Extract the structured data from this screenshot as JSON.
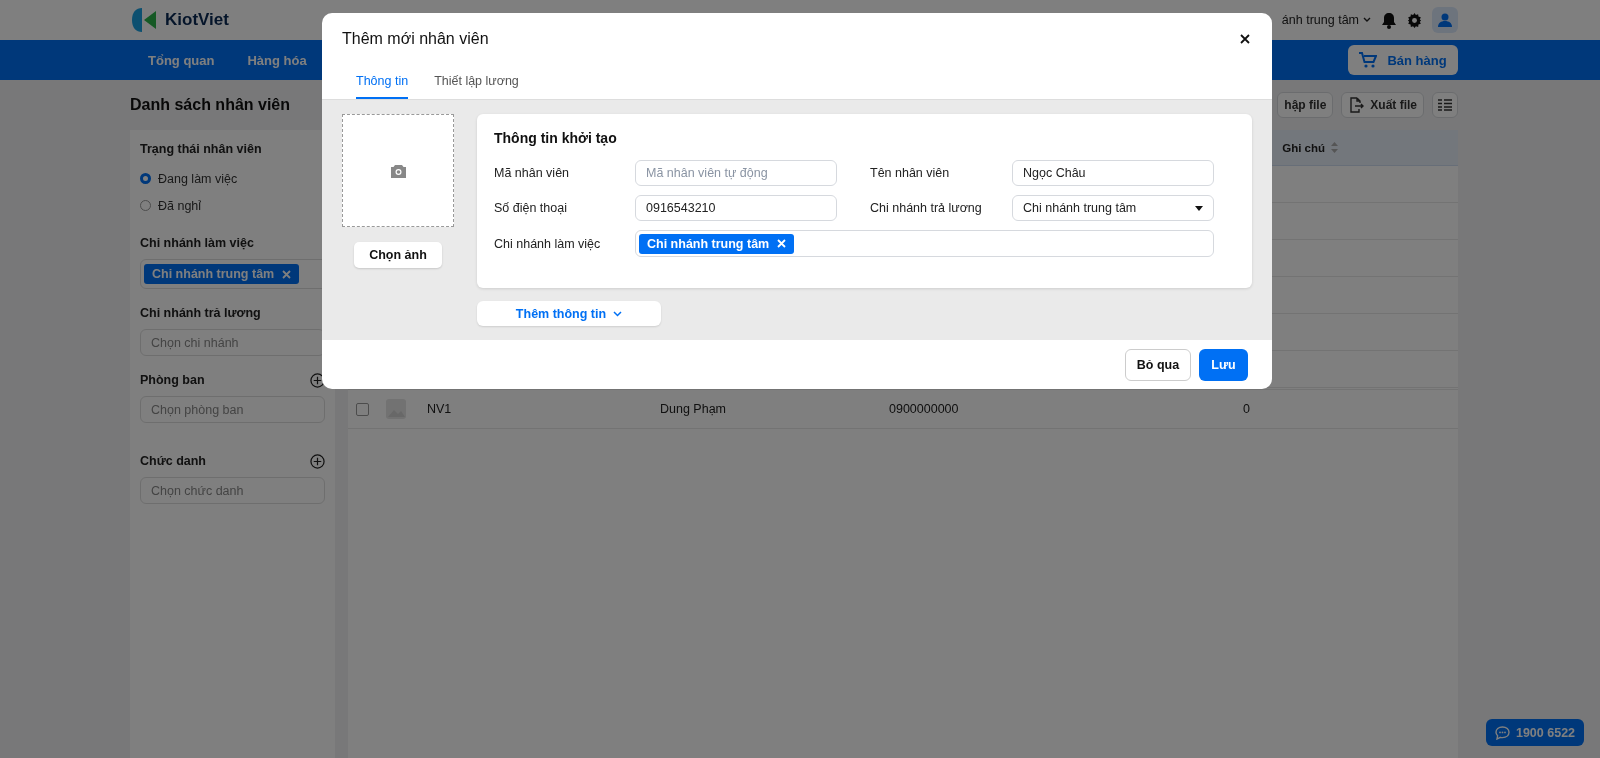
{
  "app": {
    "logo": "KiotViet",
    "branch": "ánh trung tâm",
    "sell_button": "Bán hàng"
  },
  "nav": [
    {
      "label": "Tổng quan"
    },
    {
      "label": "Hàng hóa"
    }
  ],
  "page": {
    "title": "Danh sách nhân viên",
    "actions": [
      {
        "kind": "import",
        "label": "hập file"
      },
      {
        "kind": "export",
        "label": "Xuất file"
      },
      {
        "kind": "columns"
      }
    ]
  },
  "filters": [
    {
      "kind": "radio",
      "title": "Trạng thái nhân viên",
      "options": [
        {
          "label": "Đang làm việc",
          "selected": true
        },
        {
          "label": "Đã nghỉ",
          "selected": false
        }
      ]
    },
    {
      "kind": "tags",
      "title": "Chi nhánh làm việc",
      "tags": [
        "Chi nhánh trung tâm"
      ]
    },
    {
      "kind": "select",
      "title": "Chi nhánh trả lương",
      "placeholder": "Chọn chi nhánh"
    },
    {
      "kind": "select",
      "title": "Phòng ban",
      "placeholder": "Chọn phòng ban",
      "addable": true
    },
    {
      "kind": "select",
      "title": "Chức danh",
      "placeholder": "Chọn chức danh",
      "addable": true
    }
  ],
  "table": {
    "columns": [
      {
        "label": "Ghi chú"
      }
    ],
    "rows": [
      {
        "checked": false,
        "cells": [
          "NV1",
          "Dung Phạm",
          "0900000000",
          "0"
        ]
      }
    ]
  },
  "dialog": {
    "title": "Thêm mới nhân viên",
    "tabs": [
      {
        "label": "Thông tin",
        "selected": true
      },
      {
        "label": "Thiết lập lương",
        "selected": false
      }
    ],
    "photo_button": "Chọn ảnh",
    "section_title": "Thông tin khởi tạo",
    "fields": [
      {
        "kind": "text",
        "label": "Mã nhân viên",
        "placeholder": "Mã nhân viên tự động"
      },
      {
        "kind": "text",
        "label": "Tên nhân viên",
        "value": "Ngọc Châu"
      },
      {
        "kind": "text",
        "label": "Số điện thoại",
        "value": "0916543210"
      },
      {
        "kind": "select",
        "label": "Chi nhánh trả lương",
        "value": "Chi nhánh trung tâm"
      },
      {
        "kind": "tags",
        "label": "Chi nhánh làm việc",
        "tags": [
          "Chi nhánh trung tâm"
        ]
      }
    ],
    "more_button": "Thêm thông tin",
    "buttons": [
      {
        "kind": "secondary",
        "label": "Bỏ qua"
      },
      {
        "kind": "primary",
        "label": "Lưu"
      }
    ]
  },
  "support": {
    "phone": "1900 6522"
  }
}
